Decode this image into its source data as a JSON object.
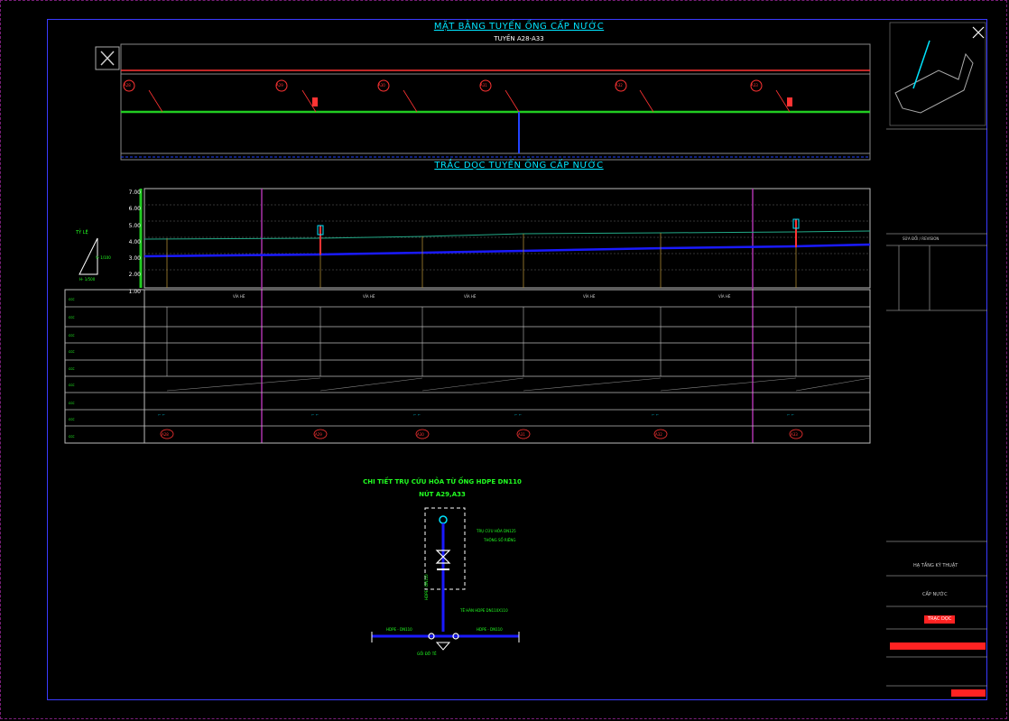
{
  "plan": {
    "title": "MẶT BẰNG TUYẾN ỐNG CẤP NƯỚC",
    "subtitle": "TUYẾN A28-A33",
    "nodes": [
      "A28",
      "A29",
      "A30",
      "A31",
      "A32",
      "A33"
    ]
  },
  "profile": {
    "title": "TRẮC DỌC TUYẾN ỐNG CẤP NƯỚC",
    "y_ticks": [
      "7.00",
      "6.00",
      "5.00",
      "4.00",
      "3.00",
      "2.00",
      "1.00"
    ],
    "vertical_scale_label": "TỶ LỆ",
    "vscale": "V- 1/100",
    "hscale": "H- 1/500",
    "station_labels": [
      "VỈA HÈ",
      "VỈA HÈ",
      "VỈA HÈ",
      "VỈA HÈ",
      "VỈA HÈ"
    ],
    "nodes": [
      "A28",
      "A29",
      "A30",
      "A31",
      "A32",
      "A33"
    ]
  },
  "detail": {
    "title": "CHI TIẾT TRỤ CỨU HỎA TỪ ỐNG HDPE DN110",
    "subtitle": "NÚT A29,A33",
    "pipe_left": "HDPE - DN110",
    "pipe_right": "HDPE - DN110",
    "tee_label": "TÊ HÀN HDPE DN110X110",
    "hydrant_label": "TRỤ CỨU HỎA DN125",
    "hydrant_sub": "THÔNG SỐ RIÊNG",
    "riser_label": "HDPE - DN110",
    "elbow_label": "GỐI ĐỠ TÊ"
  },
  "titleblock": {
    "revision_header": "SỬA ĐỔI / REVISION",
    "designer": "HẠ TẦNG KỸ THUẬT",
    "discipline": "CẤP NƯỚC",
    "stamp": "TRẠC DỌC"
  },
  "colors": {
    "background": "#000000",
    "frame": "#3a3aff",
    "pipe": "#1a1aff",
    "ground": "#22aa22",
    "accent": "#00e5ff",
    "node": "#ff3333"
  }
}
